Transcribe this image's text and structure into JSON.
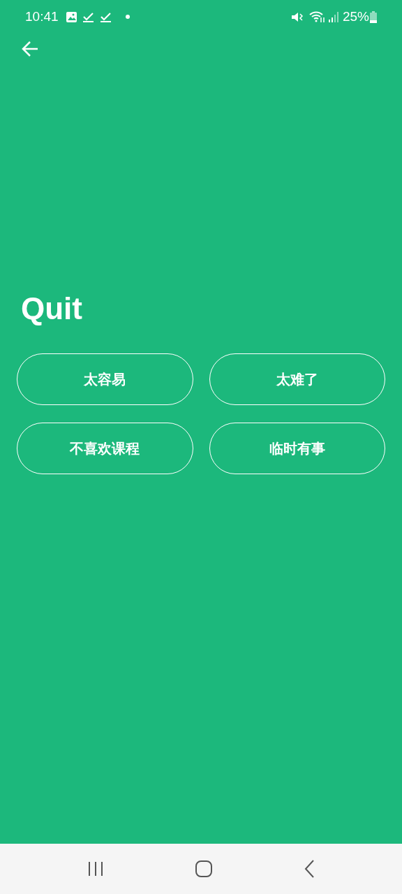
{
  "status_bar": {
    "time": "10:41",
    "battery": "25%"
  },
  "title": "Quit",
  "options": [
    {
      "label": "太容易"
    },
    {
      "label": "太难了"
    },
    {
      "label": "不喜欢课程"
    },
    {
      "label": "临时有事"
    }
  ]
}
